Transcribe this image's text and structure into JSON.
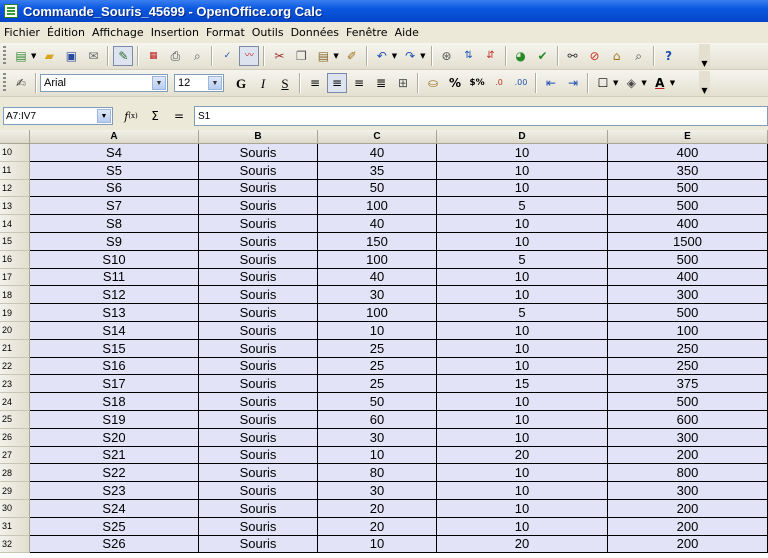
{
  "window": {
    "title": "Commande_Souris_45699 - OpenOffice.org Calc"
  },
  "menu": [
    "Fichier",
    "Édition",
    "Affichage",
    "Insertion",
    "Format",
    "Outils",
    "Données",
    "Fenêtre",
    "Aide"
  ],
  "format_toolbar": {
    "font_name": "Arial",
    "font_size": "12"
  },
  "formula_bar": {
    "name_box": "A7:IV7",
    "content": "S1",
    "fx_label": "f",
    "fx_sub": "(x)",
    "sum_label": "Σ",
    "equals_label": "="
  },
  "grid": {
    "columns": [
      "A",
      "B",
      "C",
      "D",
      "E"
    ],
    "rows": [
      {
        "num": "10",
        "cells": [
          "S4",
          "Souris",
          "40",
          "10",
          "400"
        ]
      },
      {
        "num": "11",
        "cells": [
          "S5",
          "Souris",
          "35",
          "10",
          "350"
        ]
      },
      {
        "num": "12",
        "cells": [
          "S6",
          "Souris",
          "50",
          "10",
          "500"
        ]
      },
      {
        "num": "13",
        "cells": [
          "S7",
          "Souris",
          "100",
          "5",
          "500"
        ]
      },
      {
        "num": "14",
        "cells": [
          "S8",
          "Souris",
          "40",
          "10",
          "400"
        ]
      },
      {
        "num": "15",
        "cells": [
          "S9",
          "Souris",
          "150",
          "10",
          "1500"
        ]
      },
      {
        "num": "16",
        "cells": [
          "S10",
          "Souris",
          "100",
          "5",
          "500"
        ]
      },
      {
        "num": "17",
        "cells": [
          "S11",
          "Souris",
          "40",
          "10",
          "400"
        ]
      },
      {
        "num": "18",
        "cells": [
          "S12",
          "Souris",
          "30",
          "10",
          "300"
        ]
      },
      {
        "num": "19",
        "cells": [
          "S13",
          "Souris",
          "100",
          "5",
          "500"
        ]
      },
      {
        "num": "20",
        "cells": [
          "S14",
          "Souris",
          "10",
          "10",
          "100"
        ]
      },
      {
        "num": "21",
        "cells": [
          "S15",
          "Souris",
          "25",
          "10",
          "250"
        ]
      },
      {
        "num": "22",
        "cells": [
          "S16",
          "Souris",
          "25",
          "10",
          "250"
        ]
      },
      {
        "num": "23",
        "cells": [
          "S17",
          "Souris",
          "25",
          "15",
          "375"
        ]
      },
      {
        "num": "24",
        "cells": [
          "S18",
          "Souris",
          "50",
          "10",
          "500"
        ]
      },
      {
        "num": "25",
        "cells": [
          "S19",
          "Souris",
          "60",
          "10",
          "600"
        ]
      },
      {
        "num": "26",
        "cells": [
          "S20",
          "Souris",
          "30",
          "10",
          "300"
        ]
      },
      {
        "num": "27",
        "cells": [
          "S21",
          "Souris",
          "10",
          "20",
          "200"
        ]
      },
      {
        "num": "28",
        "cells": [
          "S22",
          "Souris",
          "80",
          "10",
          "800"
        ]
      },
      {
        "num": "29",
        "cells": [
          "S23",
          "Souris",
          "30",
          "10",
          "300"
        ]
      },
      {
        "num": "30",
        "cells": [
          "S24",
          "Souris",
          "20",
          "10",
          "200"
        ]
      },
      {
        "num": "31",
        "cells": [
          "S25",
          "Souris",
          "20",
          "10",
          "200"
        ]
      },
      {
        "num": "32",
        "cells": [
          "S26",
          "Souris",
          "10",
          "20",
          "200"
        ]
      }
    ]
  }
}
